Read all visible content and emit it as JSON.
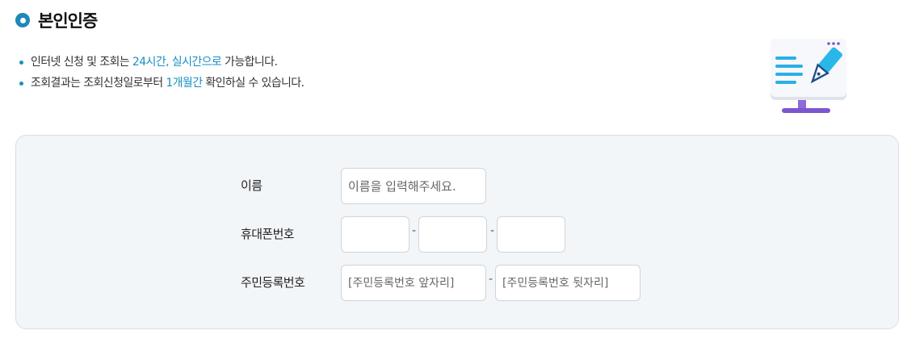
{
  "header": {
    "title": "본인인증"
  },
  "notes": [
    {
      "before": "인터넷 신청 및 조회는 ",
      "highlight": "24시간, 실시간으로",
      "after": " 가능합니다."
    },
    {
      "before": "조회결과는 조회신청일로부터 ",
      "highlight": "1개월간",
      "after": " 확인하실 수 있습니다."
    }
  ],
  "form": {
    "name": {
      "label": "이름",
      "placeholder": "이름을 입력해주세요."
    },
    "phone": {
      "label": "휴대폰번호",
      "separator": "-"
    },
    "rrn": {
      "label": "주민등록번호",
      "front_placeholder": "[주민등록번호 앞자리]",
      "back_placeholder": "[주민등록번호 뒷자리]",
      "separator": "-"
    }
  },
  "colors": {
    "accent": "#1a8fc3",
    "title_icon": "#1e88b8",
    "form_bg": "#f3f6f8"
  },
  "icons": {
    "title": "circle-bullet-icon",
    "illustration": "document-pen-monitor-icon"
  }
}
